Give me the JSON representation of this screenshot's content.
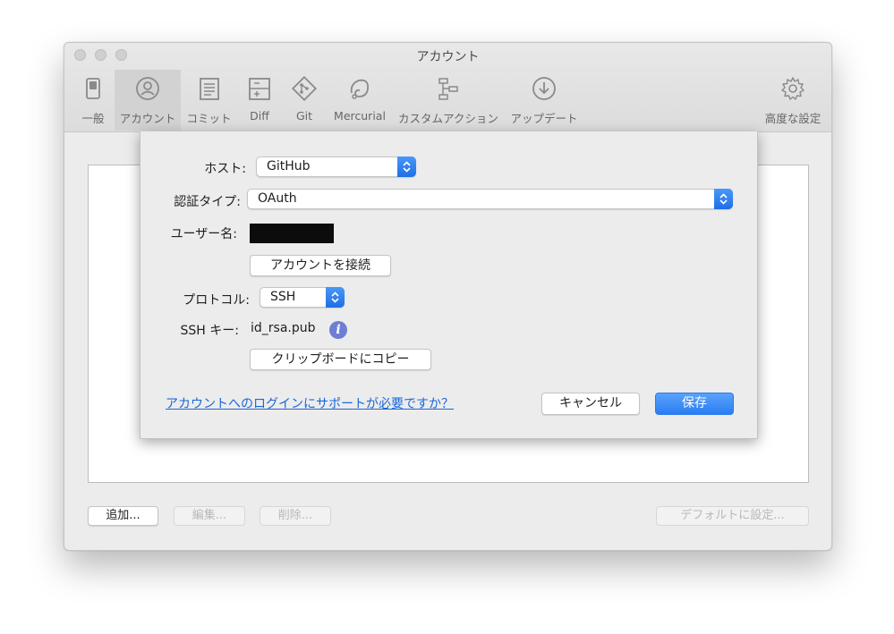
{
  "window": {
    "title": "アカウント"
  },
  "toolbar": {
    "items": [
      {
        "label": "一般",
        "icon": "switch-icon"
      },
      {
        "label": "アカウント",
        "icon": "person-icon",
        "active": true
      },
      {
        "label": "コミット",
        "icon": "document-icon"
      },
      {
        "label": "Diff",
        "icon": "diff-icon"
      },
      {
        "label": "Git",
        "icon": "git-icon"
      },
      {
        "label": "Mercurial",
        "icon": "mercurial-icon"
      },
      {
        "label": "カスタムアクション",
        "icon": "custom-action-icon"
      },
      {
        "label": "アップデート",
        "icon": "download-icon"
      },
      {
        "label": "高度な設定",
        "icon": "gear-icon"
      }
    ]
  },
  "sheet": {
    "host_label": "ホスト:",
    "host_value": "GitHub",
    "auth_label": "認証タイプ:",
    "auth_value": "OAuth",
    "username_label": "ユーザー名:",
    "connect_button": "アカウントを接続",
    "protocol_label": "プロトコル:",
    "protocol_value": "SSH",
    "ssh_key_label": "SSH キー:",
    "ssh_key_value": "id_rsa.pub",
    "info_glyph": "i",
    "copy_button": "クリップボードにコピー",
    "help_link": "アカウントへのログインにサポートが必要ですか？",
    "cancel_button": "キャンセル",
    "save_button": "保存"
  },
  "bottom_bar": {
    "add_button": "追加...",
    "edit_button": "編集...",
    "delete_button": "削除...",
    "default_button": "デフォルトに設定..."
  },
  "colors": {
    "accent": "#2a7ef3",
    "link": "#1a66d8",
    "info": "#6d7fd4"
  }
}
